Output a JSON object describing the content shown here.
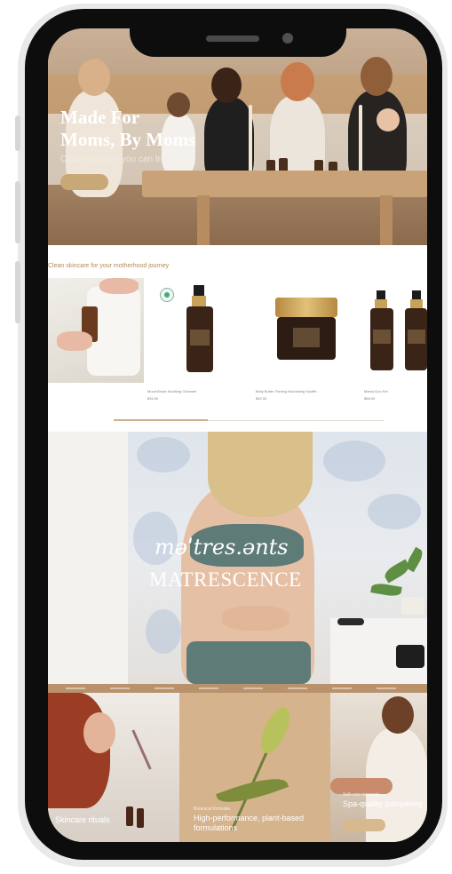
{
  "hero": {
    "title": "Made For\nMoms, By Moms",
    "subtitle": "Clean skincare you can trust"
  },
  "products": {
    "tagline": "Clean skincare for your motherhood journey",
    "items": [
      {
        "name": "Mood Boost Soothing Cleanser",
        "price": "$34.00"
      },
      {
        "name": "Belly Butter Firming Nourishing Souffle",
        "price": "$42.00"
      },
      {
        "name": "Mama Duo Set",
        "price": "$68.00"
      }
    ]
  },
  "matrescence": {
    "phonetic": "məˈtres.ənts",
    "word": "MATRESCENCE"
  },
  "tiles": {
    "tile1": {
      "tag": "",
      "text": "Skincare rituals"
    },
    "tile2": {
      "tag": "Botanical formulas",
      "text": "High-performance, plant-based\nformulations"
    },
    "tile3": {
      "tag": "Self-care moments",
      "text": "Spa-quality pampering"
    }
  },
  "colors": {
    "accent": "#c9a877",
    "bottle": "#3a2418",
    "gold": "#c9a25a",
    "sage": "#5e7b78"
  }
}
